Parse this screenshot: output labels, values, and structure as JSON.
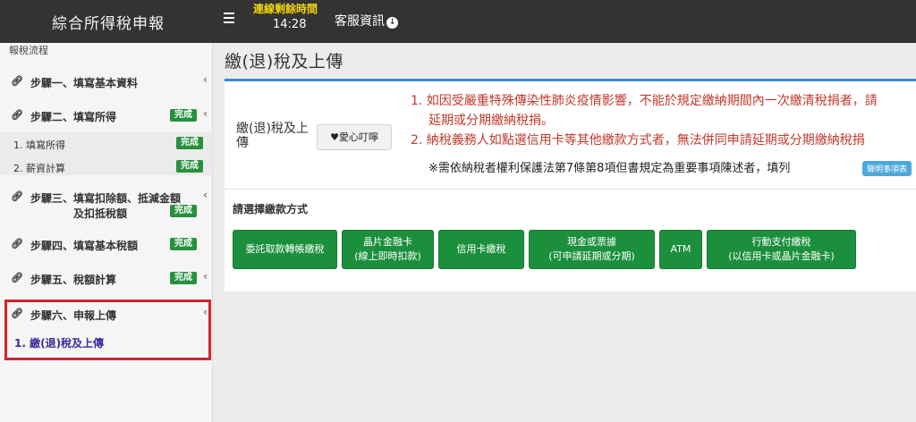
{
  "header": {
    "app_title": "綜合所得稅申報",
    "timer_label": "連線剩餘時間",
    "timer_value": "14:28",
    "service_label": "客服資訊"
  },
  "sidebar": {
    "header": "報稅流程",
    "steps": [
      {
        "label": "步驟一、填寫基本資料",
        "badge": ""
      },
      {
        "label": "步驟二、填寫所得",
        "badge": "完成"
      },
      {
        "label": "步驟三、填寫扣除額、抵減金額",
        "label2": "及扣抵稅額",
        "badge": "完成"
      },
      {
        "label": "步驟四、填寫基本稅額",
        "badge": "完成"
      },
      {
        "label": "步驟五、稅額計算",
        "badge": "完成"
      },
      {
        "label": "步驟六、申報上傳",
        "badge": ""
      }
    ],
    "step2_subitems": [
      {
        "label": "1. 填寫所得",
        "badge": "完成"
      },
      {
        "label": "2. 薪資計算",
        "badge": "完成"
      }
    ],
    "active_subitem": "1. 繳(退)稅及上傳"
  },
  "main": {
    "title": "繳(退)稅及上傳",
    "row_label": "繳(退)稅及上傳",
    "love_button": "愛心叮嚀",
    "notices": [
      "1. 如因受嚴重特殊傳染性肺炎疫情影響，不能於規定繳納期間內一次繳清稅捐者，請",
      "延期或分期繳納稅捐。",
      "2. 納稅義務人如點選信用卡等其他繳款方式者，無法併同申請延期或分期繳納稅捐"
    ],
    "note": "※需依納稅者權利保護法第7條第8項但書規定為重要事項陳述者，填列",
    "note_tag": "聲明事項表",
    "pay_label": "請選擇繳款方式",
    "pay_buttons": [
      {
        "line1": "委託取款轉帳繳稅",
        "line2": ""
      },
      {
        "line1": "晶片金融卡",
        "line2": "(線上即時扣款)"
      },
      {
        "line1": "信用卡繳稅",
        "line2": ""
      },
      {
        "line1": "現金或票據",
        "line2": "(可申請延期或分期)"
      },
      {
        "line1": "ATM",
        "line2": ""
      },
      {
        "line1": "行動支付繳稅",
        "line2": "(以信用卡或晶片金融卡)"
      }
    ]
  },
  "colors": {
    "topbar": "#333333",
    "timer_label": "#f4d80a",
    "badge": "#27913f",
    "pay_button": "#1b8f3c",
    "notice": "#c0392b",
    "highlight_border": "#d6232c",
    "panel_accent": "#3b8ad9"
  }
}
